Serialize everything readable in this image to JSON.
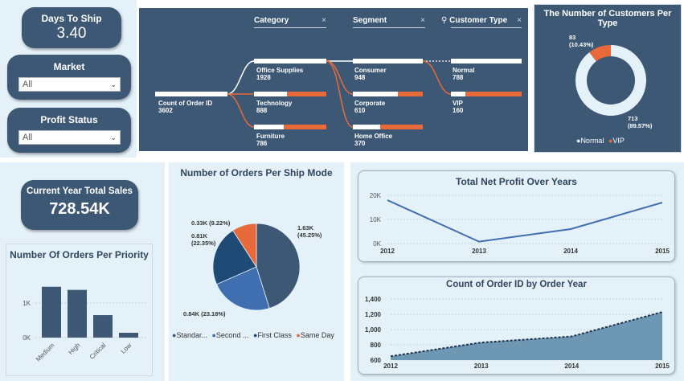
{
  "kpis": {
    "days_to_ship": {
      "label": "Days To Ship",
      "value": "3.40"
    },
    "total_sales": {
      "label": "Current Year Total Sales",
      "value": "728.54K"
    }
  },
  "filters": {
    "market": {
      "label": "Market",
      "value": "All"
    },
    "profit_status": {
      "label": "Profit Status",
      "value": "All"
    }
  },
  "decomposition_tree": {
    "headers": {
      "category": "Category",
      "segment": "Segment",
      "customer_type": "Customer Type"
    },
    "root": {
      "label": "Count of Order ID",
      "value": "3602"
    },
    "category": [
      {
        "label": "Office Supplies",
        "value": "1928",
        "fraction": 1.0
      },
      {
        "label": "Technology",
        "value": "888",
        "fraction": 0.46
      },
      {
        "label": "Furniture",
        "value": "786",
        "fraction": 0.41
      }
    ],
    "segment": [
      {
        "label": "Consumer",
        "value": "948",
        "fraction": 1.0
      },
      {
        "label": "Corporate",
        "value": "610",
        "fraction": 0.64
      },
      {
        "label": "Home Office",
        "value": "370",
        "fraction": 0.39
      }
    ],
    "customer_type": [
      {
        "label": "Normal",
        "value": "788",
        "fraction": 1.0
      },
      {
        "label": "VIP",
        "value": "160",
        "fraction": 0.2
      }
    ]
  },
  "colors": {
    "navy": "#3d5875",
    "orange": "#e8693a",
    "light_panel": "#e4f1f8",
    "blue_mid": "#3f6fb0",
    "blue_dark": "#1e4a75"
  },
  "chart_data": [
    {
      "type": "pie",
      "variant": "donut",
      "title": "The Number of Customers Per Type",
      "slices": [
        {
          "name": "Normal",
          "value": 713,
          "label": "713\n(89.57%)",
          "color": "#e4f1f8"
        },
        {
          "name": "VIP",
          "value": 83,
          "label": "83\n(10.43%)",
          "color": "#e8693a"
        }
      ],
      "legend": [
        "Normal",
        "VIP"
      ],
      "legend_position": "bottom"
    },
    {
      "type": "bar",
      "title": "Number Of Orders Per Priority",
      "categories": [
        "Medium",
        "High",
        "Critical",
        "Low"
      ],
      "values": [
        1470,
        1380,
        650,
        140
      ],
      "ylim": [
        0,
        2000
      ],
      "yticks": [
        "0K",
        "1K"
      ],
      "grid": true
    },
    {
      "type": "pie",
      "title": "Number of Orders Per Ship Mode",
      "slices": [
        {
          "name": "Standard Class",
          "value": 1630,
          "label": "1.63K\n(45.25%)",
          "color": "#3d5875"
        },
        {
          "name": "Second Class",
          "value": 840,
          "label": "0.84K (23.18%)",
          "color": "#3f6fb0"
        },
        {
          "name": "First Class",
          "value": 810,
          "label": "0.81K\n(22.35%)",
          "color": "#1e4a75"
        },
        {
          "name": "Same Day",
          "value": 330,
          "label": "0.33K (9.22%)",
          "color": "#e8693a"
        }
      ],
      "legend": [
        "Standar...",
        "Second ...",
        "First Class",
        "Same Day"
      ],
      "legend_position": "bottom"
    },
    {
      "type": "line",
      "title": "Total Net Profit Over Years",
      "x": [
        "2012",
        "2013",
        "2014",
        "2015"
      ],
      "values": [
        18000,
        800,
        6000,
        17000
      ],
      "ylim": [
        0,
        20000
      ],
      "yticks": [
        "0K",
        "10K",
        "20K"
      ]
    },
    {
      "type": "area",
      "title": "Count of Order ID by Order Year",
      "x": [
        "2012",
        "2013",
        "2014",
        "2015"
      ],
      "values": [
        650,
        830,
        910,
        1230
      ],
      "ylim": [
        600,
        1400
      ],
      "yticks": [
        "600",
        "800",
        "1,000",
        "1,200",
        "1,400"
      ]
    }
  ]
}
